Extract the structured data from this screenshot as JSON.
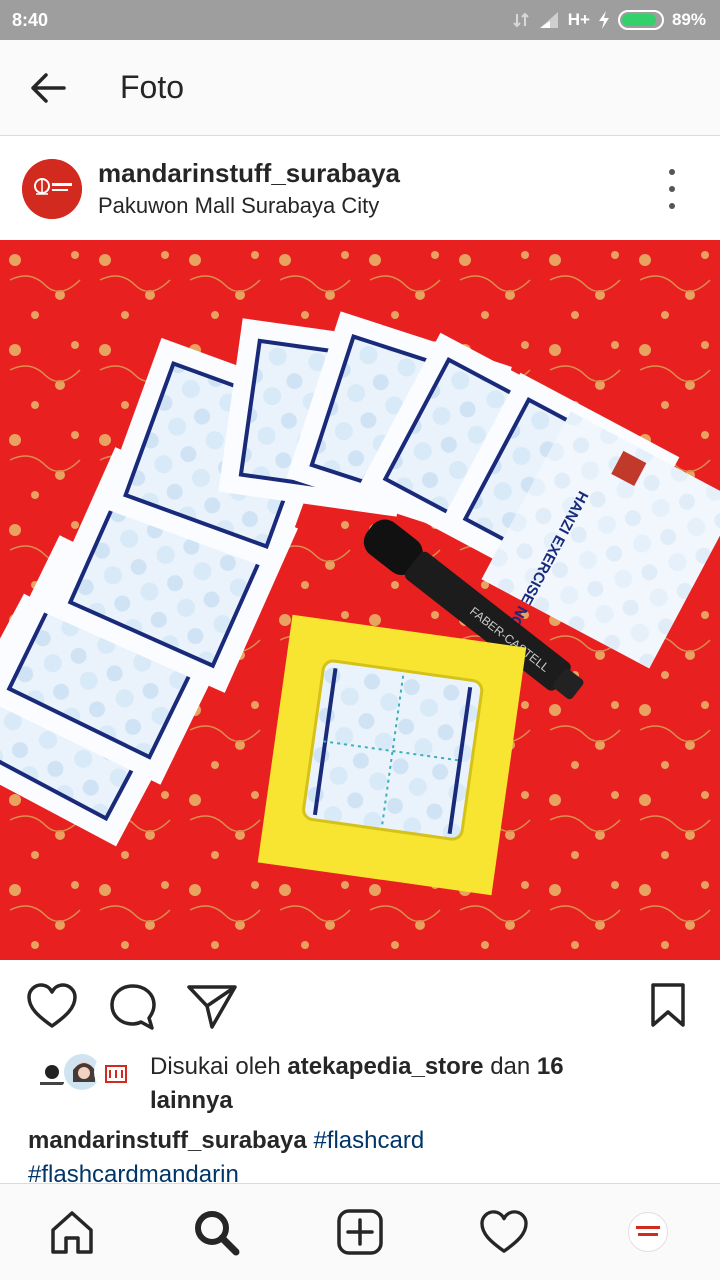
{
  "status_bar": {
    "time": "8:40",
    "network": "H+",
    "battery_percent": "89%",
    "battery_level": 0.89,
    "battery_color": "#33d16b"
  },
  "header": {
    "title": "Foto"
  },
  "post": {
    "username": "mandarinstuff_surabaya",
    "location": "Pakuwon Mall Surabaya City",
    "photo_text": {
      "note_title": "HANZI EXERCISE NOTE",
      "marker_brand": "FABER-CASTELL"
    }
  },
  "likes": {
    "prefix": "Disukai oleh",
    "user": "atekapedia_store",
    "middle": "dan",
    "count": "16",
    "suffix": "lainnya"
  },
  "caption": {
    "username": "mandarinstuff_surabaya",
    "tags": [
      "#flashcard",
      "#flashcardmandarin"
    ]
  },
  "icons": {
    "back": "arrow-left-icon",
    "more": "more-vertical-icon",
    "like": "heart-icon",
    "comment": "comment-icon",
    "share": "send-icon",
    "save": "bookmark-icon",
    "home": "home-icon",
    "search": "search-icon",
    "add": "add-icon",
    "activity": "heart-icon",
    "profile": "profile-avatar"
  },
  "colors": {
    "link": "#003569",
    "brand_red": "#d32a1f",
    "photo_bg": "#e8201f"
  }
}
